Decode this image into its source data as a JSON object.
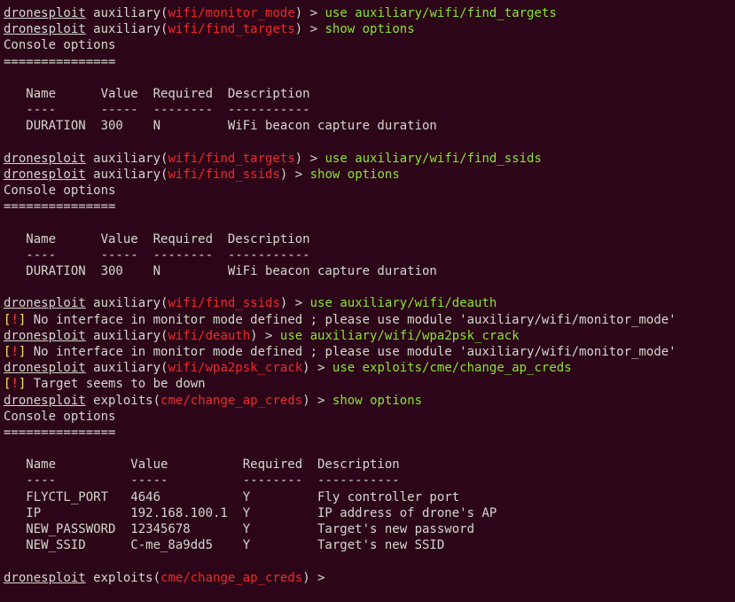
{
  "prog": "dronesploit",
  "aux_label": "auxiliary",
  "expl_label": "exploits",
  "modules": {
    "monitor_mode": "wifi/monitor_mode",
    "find_targets": "wifi/find_targets",
    "find_ssids": "wifi/find_ssids",
    "deauth": "wifi/deauth",
    "wpa2psk_crack": "wifi/wpa2psk_crack",
    "change_ap_creds": "cme/change_ap_creds"
  },
  "cmds": {
    "use_find_targets": "use auxiliary/wifi/find_targets",
    "show_options": "show options",
    "use_find_ssids": "use auxiliary/wifi/find_ssids",
    "use_deauth": "use auxiliary/wifi/deauth",
    "use_wpa2psk": "use auxiliary/wifi/wpa2psk_crack",
    "use_change_ap": "use exploits/cme/change_ap_creds"
  },
  "console_options_title": "Console options",
  "console_options_sep": "===============",
  "warn_bracket_open": "[",
  "warn_bang": "!",
  "warn_bracket_close": "]",
  "warn_no_monitor": " No interface in monitor mode defined ; please use module 'auxiliary/wifi/monitor_mode'",
  "warn_target_down": " Target seems to be down",
  "table1": {
    "header": "   Name      Value  Required  Description",
    "div": "   ----      -----  --------  -----------",
    "row": "   DURATION  300    N         WiFi beacon capture duration"
  },
  "table2": {
    "header": "   Name      Value  Required  Description",
    "div": "   ----      -----  --------  -----------",
    "row": "   DURATION  300    N         WiFi beacon capture duration"
  },
  "table3": {
    "header": "   Name          Value          Required  Description",
    "div": "   ----          -----          --------  -----------",
    "row1": "   FLYCTL_PORT   4646           Y         Fly controller port",
    "row2": "   IP            192.168.100.1  Y         IP address of drone's AP",
    "row3": "   NEW_PASSWORD  12345678       Y         Target's new password",
    "row4": "   NEW_SSID      C-me_8a9dd5    Y         Target's new SSID"
  }
}
